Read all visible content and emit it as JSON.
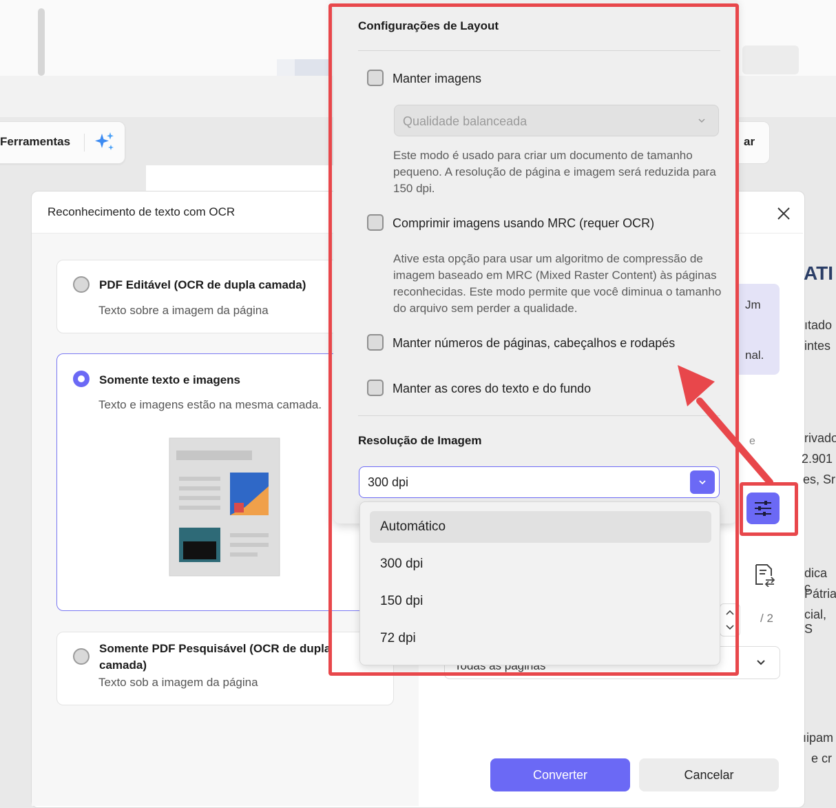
{
  "toolbar": {
    "tools_label": "Ferramentas",
    "right_partial": "ar"
  },
  "dialog": {
    "title": "Reconhecimento de texto com OCR",
    "options": [
      {
        "title": "PDF Editável (OCR de dupla camada)",
        "desc": "Texto sobre a imagem da página",
        "selected": false
      },
      {
        "title": "Somente texto e imagens",
        "desc": "Texto e imagens estão na mesma camada.",
        "selected": true
      },
      {
        "title": "Somente PDF Pesquisável (OCR de dupla",
        "title_line2": "camada)",
        "desc": "Texto sob a imagem da página",
        "selected": false
      }
    ],
    "right_fragments": {
      "heading": "ATI",
      "info1": "Jm",
      "info2": "nal.",
      "t1": "ıtado",
      "t2": "intes",
      "t3": "e",
      "t4": "rivado",
      "t5": "2.901",
      "t6": "es, Sr",
      "t7": "dica c",
      "t8": "Pátria",
      "t9": "cial, S",
      "t10": "ıipam",
      "t11": "e cr"
    },
    "page_count": "/ 2",
    "page_range_partial": "Todas as páginas",
    "convert_label": "Converter",
    "cancel_label": "Cancelar"
  },
  "layout_popup": {
    "title": "Configurações de Layout",
    "keep_images": {
      "label": "Manter imagens",
      "checked": false
    },
    "quality_select": {
      "value": "Qualidade balanceada"
    },
    "quality_desc": "Este modo é usado para criar um documento de tamanho pequeno. A resolução de página e imagem será reduzida para 150 dpi.",
    "mrc": {
      "label": "Comprimir imagens usando MRC (requer OCR)",
      "checked": false
    },
    "mrc_desc": "Ative esta opção para usar um algoritmo de compressão de imagem baseado em MRC (Mixed Raster Content) às páginas reconhecidas. Este modo permite que você diminua o tamanho do arquivo sem perder a qualidade.",
    "keep_headers": {
      "label": "Manter números de páginas, cabeçalhos e rodapés",
      "checked": false
    },
    "keep_colors": {
      "label": "Manter as cores do texto e do fundo",
      "checked": false
    },
    "resolution_title": "Resolução de Imagem",
    "resolution_value": "300 dpi",
    "resolution_options": [
      "Automático",
      "300 dpi",
      "150 dpi",
      "72 dpi"
    ]
  },
  "colors": {
    "accent": "#6b69f5",
    "annotation": "#e8474b"
  }
}
